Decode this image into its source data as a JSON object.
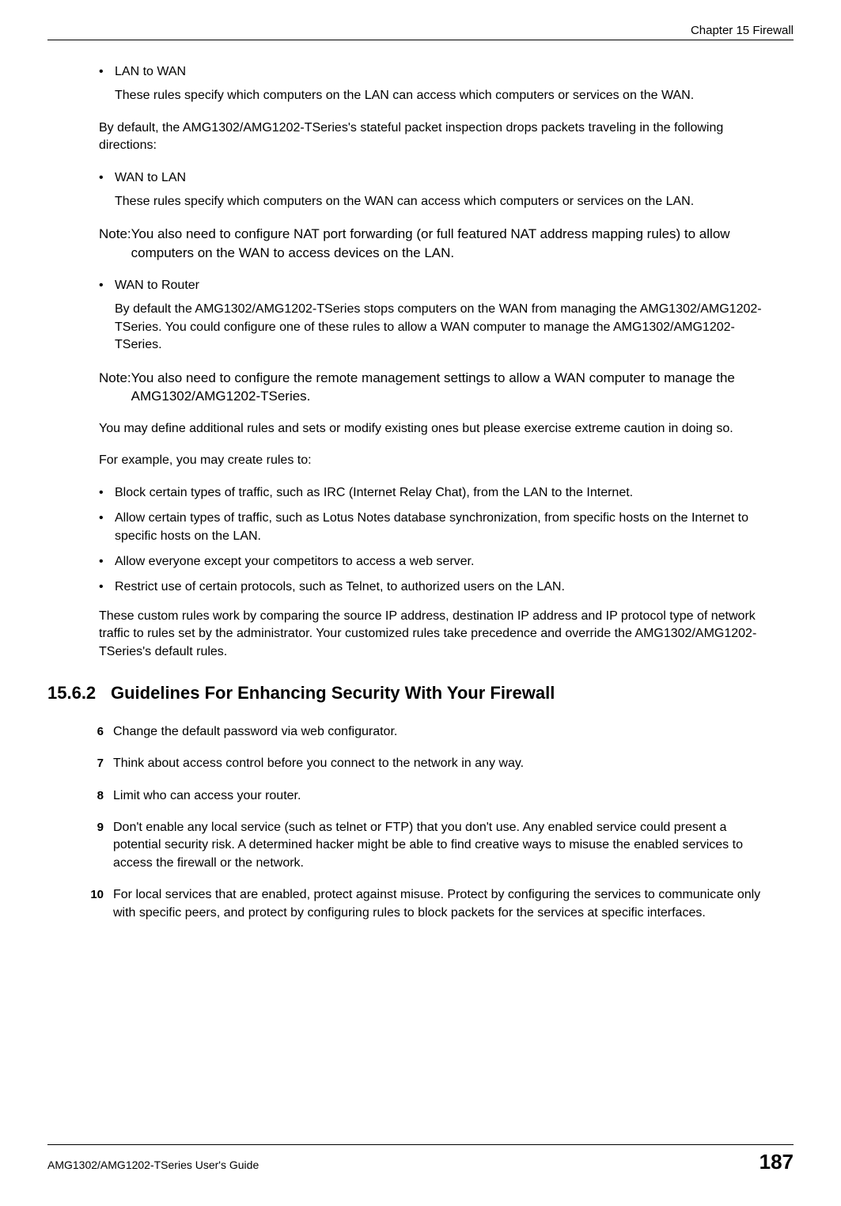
{
  "header": {
    "chapter": "Chapter 15 Firewall"
  },
  "body": {
    "bullet1_title": "LAN to WAN",
    "bullet1_desc": "These rules specify which computers on the LAN can access which computers or services on the WAN.",
    "para_default_drop": "By default, the AMG1302/AMG1202-TSeries's stateful packet inspection drops packets traveling in the following directions:",
    "bullet2_title": "WAN to LAN",
    "bullet2_desc": "These rules specify which computers on the WAN can access which computers or services on the LAN.",
    "note1_label": "Note: ",
    "note1_body": "You also need to configure NAT port forwarding (or full featured NAT address mapping rules) to allow computers on the WAN to access devices on the LAN.",
    "bullet3_title": "WAN to Router",
    "bullet3_desc": "By default the AMG1302/AMG1202-TSeries stops computers on the WAN from managing the AMG1302/AMG1202-TSeries. You could configure one of these rules to allow a WAN computer to manage the AMG1302/AMG1202-TSeries.",
    "note2_label": "Note: ",
    "note2_body": "You also need to configure the remote management settings to allow a WAN computer to manage the AMG1302/AMG1202-TSeries.",
    "para_caution": "You may define additional rules and sets or modify existing ones but please exercise extreme caution in doing so.",
    "para_example_intro": "For example, you may create rules to:",
    "ex_bullets": [
      "Block certain types of traffic, such as IRC (Internet Relay Chat), from the LAN to the Internet.",
      "Allow certain types of traffic, such as Lotus Notes database synchronization, from specific hosts on the Internet to specific hosts on the LAN.",
      "Allow everyone except your competitors to access a web server.",
      "Restrict use of certain protocols, such as Telnet, to authorized users on the LAN."
    ],
    "para_custom_rules": "These custom rules work by comparing the source IP address, destination IP address and IP protocol type of network traffic to rules set by the administrator. Your customized rules take precedence and override the AMG1302/AMG1202-TSeries's default rules."
  },
  "section": {
    "number": "15.6.2",
    "title": "Guidelines For Enhancing Security With Your Firewall",
    "items": [
      {
        "num": "6",
        "text": "Change the default password via web configurator."
      },
      {
        "num": "7",
        "text": "Think about access control before you connect to the network in any way."
      },
      {
        "num": "8",
        "text": "Limit who can access your router."
      },
      {
        "num": "9",
        "text": "Don't enable any local service (such as telnet or FTP) that you don't use. Any enabled service could present a potential security risk. A determined hacker might be able to find creative ways to misuse the enabled services to access the firewall or the network."
      },
      {
        "num": "10",
        "text": "For local services that are enabled, protect against misuse. Protect by configuring the services to communicate only with specific peers, and protect by configuring rules to block packets for the services at specific interfaces."
      }
    ]
  },
  "footer": {
    "guide": "AMG1302/AMG1202-TSeries User's Guide",
    "page": "187"
  }
}
